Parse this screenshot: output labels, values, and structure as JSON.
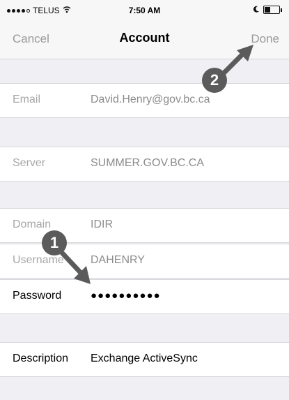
{
  "status_bar": {
    "carrier": "TELUS",
    "time": "7:50 AM"
  },
  "nav": {
    "cancel_label": "Cancel",
    "title": "Account",
    "done_label": "Done"
  },
  "fields": [
    {
      "label": "Email",
      "value": "David.Henry@gov.bc.ca"
    },
    {
      "label": "Server",
      "value": "SUMMER.GOV.BC.CA"
    },
    {
      "label": "Domain",
      "value": "IDIR"
    },
    {
      "label": "Username",
      "value": "DAHENRY"
    },
    {
      "label": "Password",
      "value": "●●●●●●●●●●"
    },
    {
      "label": "Description",
      "value": "Exchange ActiveSync"
    }
  ],
  "annotations": [
    {
      "number": "1",
      "color": "#5b5b5b"
    },
    {
      "number": "2",
      "color": "#5b5b5b"
    }
  ],
  "colors": {
    "background": "#efeff4",
    "nav_text_disabled": "#9a9a9a"
  }
}
